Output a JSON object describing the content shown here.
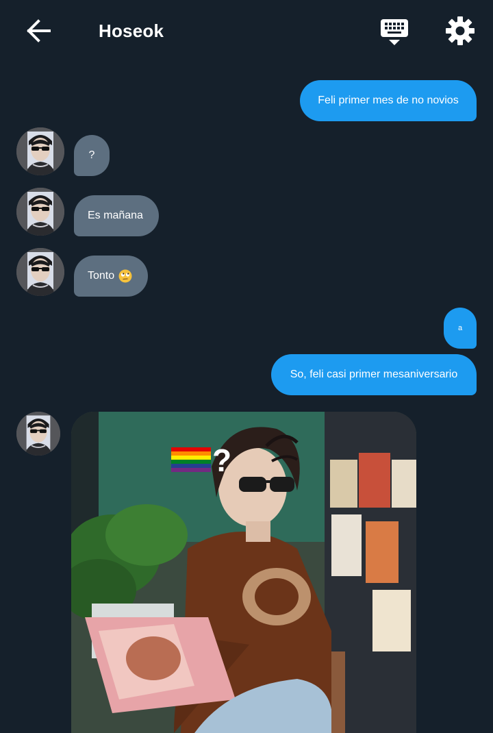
{
  "header": {
    "title": "Hoseok",
    "back_icon": "arrow-left-icon",
    "keyboard_icon": "keyboard-icon",
    "settings_icon": "gear-icon"
  },
  "messages": [
    {
      "side": "out",
      "text": "Feli primer mes de no novios"
    },
    {
      "side": "in",
      "text": "?"
    },
    {
      "side": "in",
      "text": "Es mañana"
    },
    {
      "side": "in",
      "text": "Tonto",
      "emoji": "rolling-eyes-emoji"
    },
    {
      "side": "out",
      "text": "a"
    },
    {
      "side": "out",
      "text": "So, feli casi primer mesaniversario"
    },
    {
      "side": "in",
      "type": "image",
      "image_icon": "meme-photo",
      "overlay_text": "?"
    }
  ],
  "colors": {
    "background": "#15202b",
    "outgoing_bubble": "#1d9bf0",
    "incoming_bubble": "#5d6f80"
  }
}
